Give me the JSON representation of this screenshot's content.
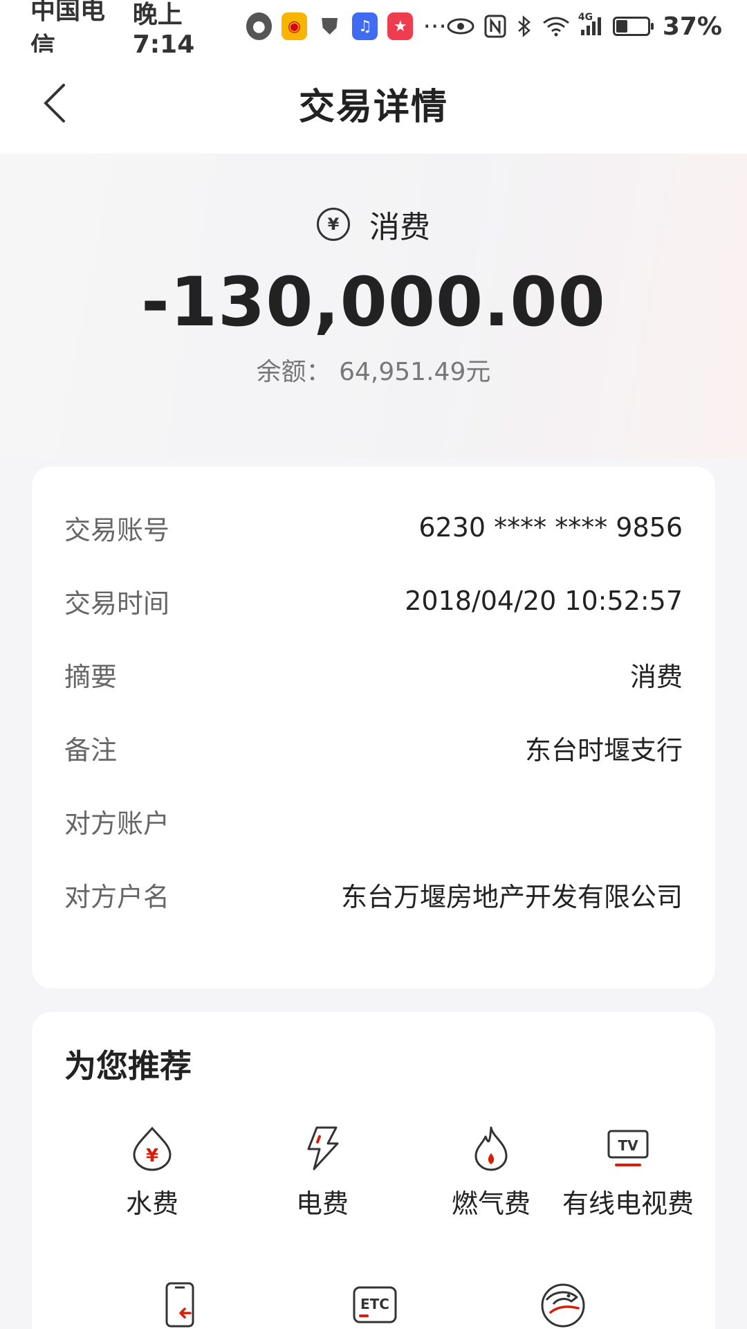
{
  "status_bar": {
    "carrier": "中国电信",
    "time": "晚上7:14",
    "network": "4G",
    "battery_level": 0.37,
    "battery_text": "37%",
    "overflow": "···"
  },
  "nav": {
    "title": "交易详情"
  },
  "summary": {
    "type_icon_glyph": "¥",
    "type_label": "消费",
    "amount": "-130,000.00",
    "balance_label": "余额：",
    "balance_value": "64,951.49元"
  },
  "details": [
    {
      "label": "交易账号",
      "value": "6230 **** **** 9856"
    },
    {
      "label": "交易时间",
      "value": "2018/04/20 10:52:57"
    },
    {
      "label": "摘要",
      "value": "消费"
    },
    {
      "label": "备注",
      "value": "东台时堰支行"
    },
    {
      "label": "对方账户",
      "value": ""
    },
    {
      "label": "对方户名",
      "value": "东台万堰房地产开发有限公司"
    }
  ],
  "recommend": {
    "title": "为您推荐",
    "items": [
      {
        "label": "水费",
        "icon": "water-drop-icon",
        "glyph": "¥"
      },
      {
        "label": "电费",
        "icon": "lightning-icon"
      },
      {
        "label": "燃气费",
        "icon": "flame-icon"
      },
      {
        "label": "有线电视费",
        "icon": "tv-icon",
        "glyph": "TV"
      },
      {
        "label": "",
        "icon": "phone-icon"
      },
      {
        "label": "",
        "icon": "etc-icon",
        "glyph": "ETC"
      },
      {
        "label": "",
        "icon": "bird-icon"
      }
    ]
  },
  "colors": {
    "accent": "#d81e06",
    "text": "#222222",
    "muted": "#666666",
    "background": "#f5f5f7"
  }
}
